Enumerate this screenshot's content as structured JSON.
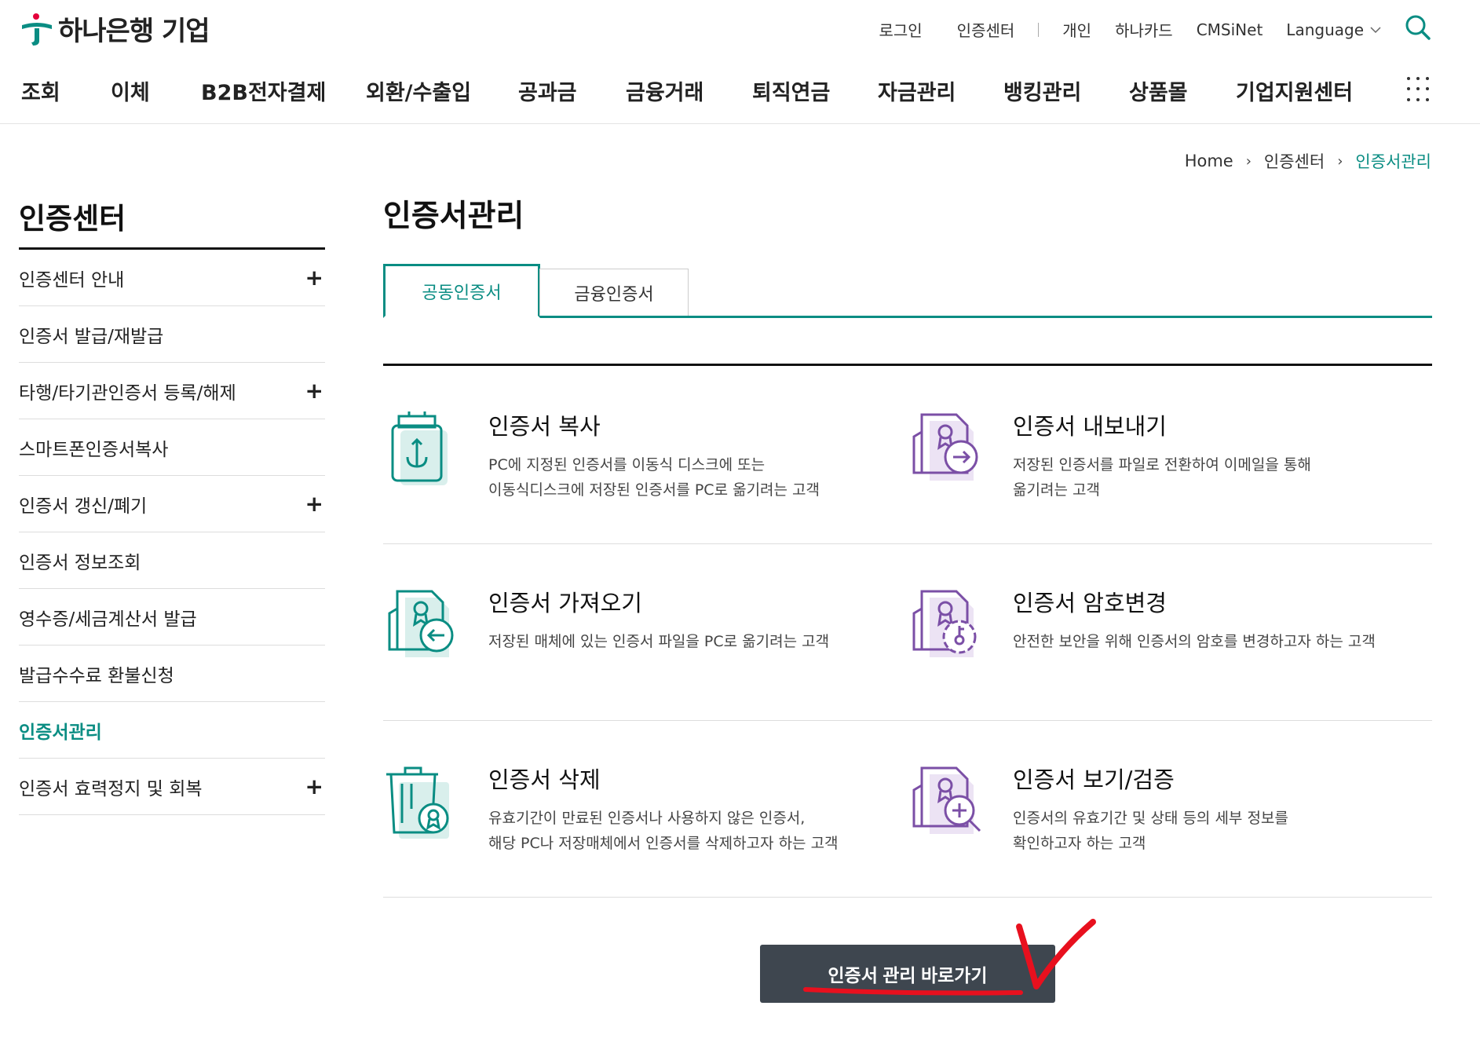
{
  "brand": {
    "name": "하나은행 기업",
    "accent": "#0a8d83",
    "logo_red": "#e4003a"
  },
  "util": {
    "login": "로그인",
    "cert_center": "인증센터",
    "personal": "개인",
    "card": "하나카드",
    "cmsinet": "CMSiNet",
    "language": "Language"
  },
  "gnb": [
    "조회",
    "이체",
    "B2B전자결제",
    "외환/수출입",
    "공과금",
    "금융거래",
    "퇴직연금",
    "자금관리",
    "뱅킹관리",
    "상품몰",
    "기업지원센터"
  ],
  "breadcrumb": {
    "home": "Home",
    "level1": "인증센터",
    "current": "인증서관리"
  },
  "lnb": {
    "title": "인증센터",
    "items": [
      {
        "label": "인증센터 안내",
        "expandable": true
      },
      {
        "label": "인증서 발급/재발급",
        "expandable": false
      },
      {
        "label": "타행/타기관인증서 등록/해제",
        "expandable": true
      },
      {
        "label": "스마트폰인증서복사",
        "expandable": false
      },
      {
        "label": "인증서 갱신/폐기",
        "expandable": true
      },
      {
        "label": "인증서 정보조회",
        "expandable": false
      },
      {
        "label": "영수증/세금계산서 발급",
        "expandable": false
      },
      {
        "label": "발급수수료 환불신청",
        "expandable": false
      },
      {
        "label": "인증서관리",
        "expandable": false,
        "active": true
      },
      {
        "label": "인증서 효력정지 및 회복",
        "expandable": true
      }
    ]
  },
  "main": {
    "title": "인증서관리",
    "tabs": [
      {
        "label": "공동인증서",
        "selected": true
      },
      {
        "label": "금융인증서",
        "selected": false
      }
    ],
    "cards": [
      {
        "title": "인증서 복사",
        "desc": "PC에 지정된 인증서를 이동식 디스크에 또는\n이동식디스크에 저장된 인증서를 PC로 옮기려는 고객",
        "icon": "usb-drive-icon"
      },
      {
        "title": "인증서 내보내기",
        "desc": "저장된 인증서를 파일로 전환하여 이메일을 통해\n옮기려는 고객",
        "icon": "certificate-export-icon"
      },
      {
        "title": "인증서 가져오기",
        "desc": "저장된 매체에 있는 인증서 파일을 PC로 옮기려는 고객",
        "icon": "certificate-import-icon"
      },
      {
        "title": "인증서 암호변경",
        "desc": "안전한 보안을 위해 인증서의 암호를 변경하고자 하는 고객",
        "icon": "certificate-password-icon"
      },
      {
        "title": "인증서 삭제",
        "desc": "유효기간이 만료된 인증서나 사용하지 않은 인증서,\n해당 PC나 저장매체에서 인증서를 삭제하고자 하는 고객",
        "icon": "certificate-delete-icon"
      },
      {
        "title": "인증서 보기/검증",
        "desc": "인증서의 유효기간 및 상태 등의 세부 정보를\n확인하고자 하는 고객",
        "icon": "certificate-view-icon"
      }
    ],
    "go_button": "인증서 관리 바로가기"
  },
  "colors": {
    "teal": "#0a8d83",
    "purple": "#7b4fa6",
    "button_bg": "#3e464f",
    "annotation_red": "#e8101e"
  }
}
